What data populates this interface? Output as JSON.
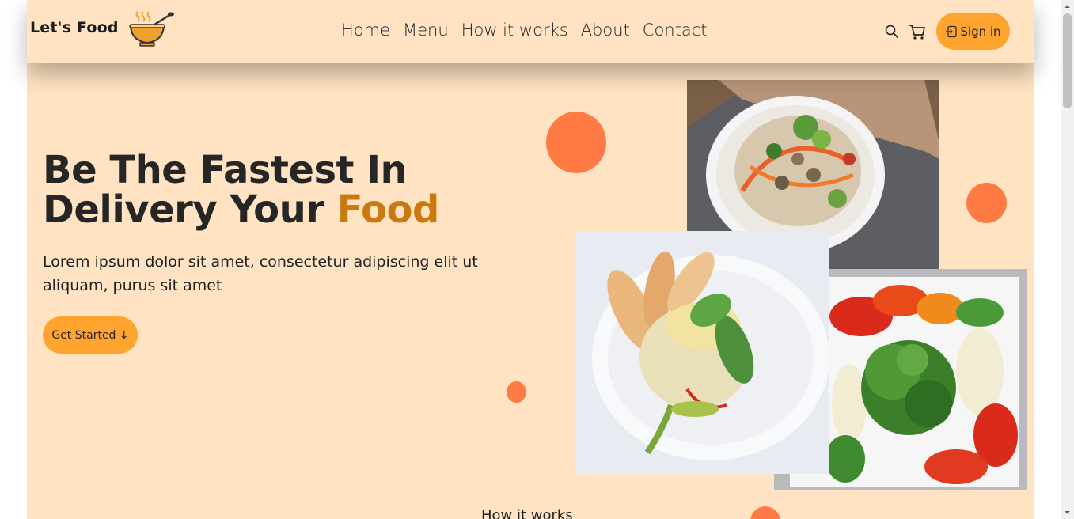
{
  "brand": {
    "name": "Let's Food",
    "logo": "soup-bowl-logo"
  },
  "nav": {
    "links": [
      "Home",
      "Menu",
      "How it works",
      "About",
      "Contact"
    ],
    "search_icon": "search-icon",
    "cart_icon": "cart-icon",
    "signin_label": "Sign in"
  },
  "hero": {
    "title_line1": "Be The Fastest In",
    "title_line2_pre": "Delivery Your ",
    "title_line2_accent": "Food",
    "description": "Lorem ipsum dolor sit amet, consectetur adipiscing elit ut aliquam, purus sit amet",
    "cta_label": "Get Started ↓"
  },
  "next_section": {
    "heading": "How it works"
  },
  "colors": {
    "background": "#ffe3c2",
    "accent_button": "#ffa52f",
    "accent_text": "#c9790e",
    "decor_circle": "#ff7a45"
  }
}
